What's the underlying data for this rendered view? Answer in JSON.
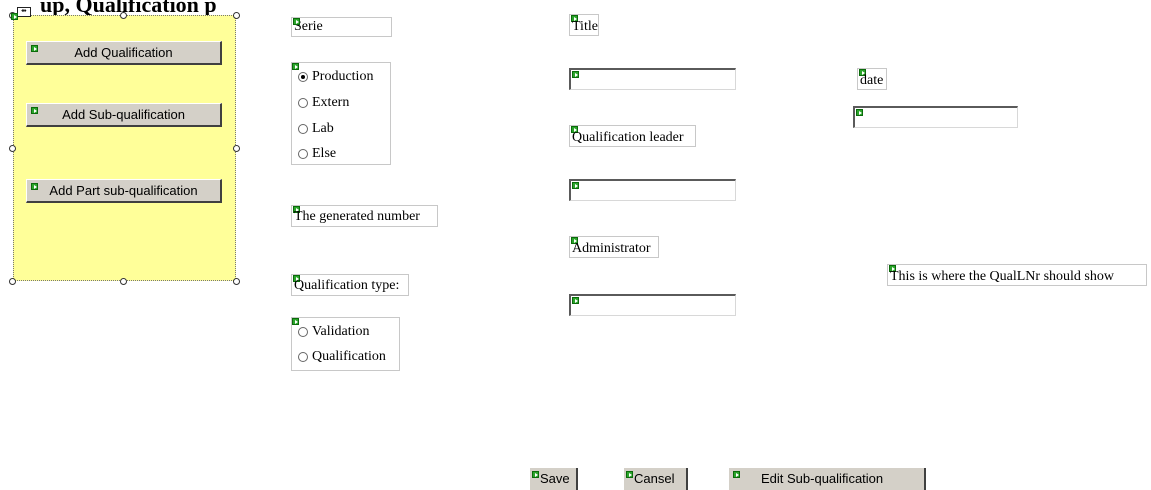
{
  "header_partial": "up, Qualification p",
  "move_glyph": "⇹",
  "sidebar": {
    "buttons": [
      {
        "label": "Add Qualification"
      },
      {
        "label": "Add Sub-qualification"
      },
      {
        "label": "Add Part sub-qualification"
      }
    ]
  },
  "form": {
    "serie_label": "Serie",
    "serie_options": [
      "Production",
      "Extern",
      "Lab",
      "Else"
    ],
    "serie_selected": "Production",
    "generated_number_label": "The generated number",
    "qualification_type_label": "Qualification type:",
    "qualification_type_options": [
      "Validation",
      "Qualification"
    ],
    "title_label": "Title",
    "title_value": "",
    "qualification_leader_label": "Qualification leader",
    "qualification_leader_value": "",
    "administrator_label": "Administrator",
    "administrator_value": "",
    "date_label": "date",
    "date_value": "",
    "qualnr_placeholder_text": "This is where the QualLNr should show"
  },
  "footer": {
    "save_label": "Save",
    "cancel_label": "Cansel",
    "edit_sub_label": "Edit Sub-qualification"
  },
  "colors": {
    "panel_yellow": "#ffff99",
    "button_face": "#d4d0c8",
    "marker_green": "#2aa52a"
  }
}
